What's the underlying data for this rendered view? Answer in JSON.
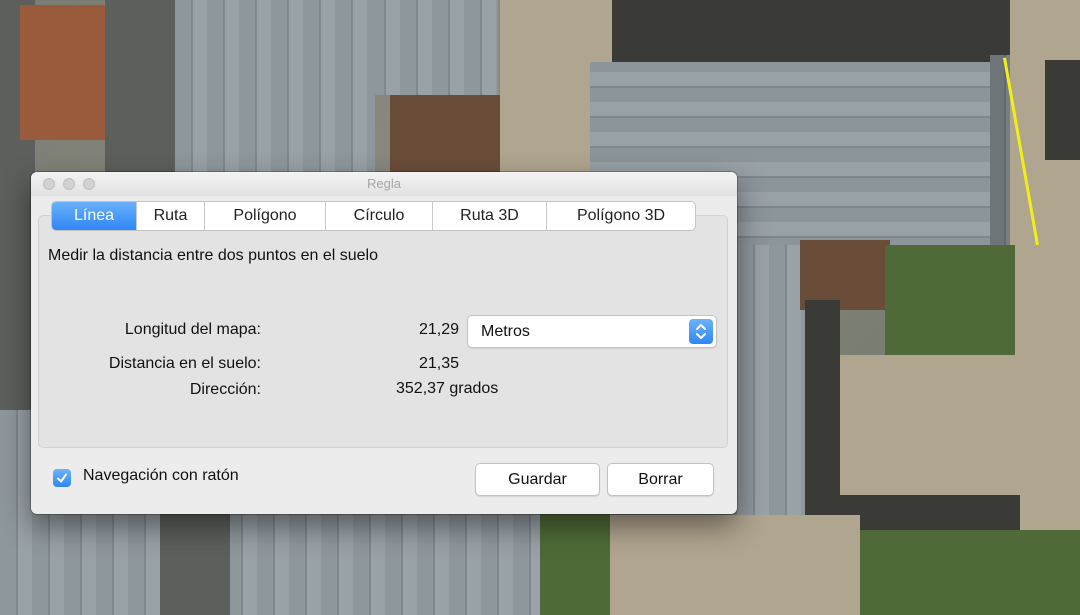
{
  "window": {
    "title": "Regla"
  },
  "tabs": [
    "Línea",
    "Ruta",
    "Polígono",
    "Círculo",
    "Ruta 3D",
    "Polígono 3D"
  ],
  "active_tab": "Línea",
  "description": "Medir la distancia entre dos puntos en el suelo",
  "measurements": {
    "map_length": {
      "label": "Longitud del mapa:",
      "value": "21,29"
    },
    "ground_distance": {
      "label": "Distancia en el suelo:",
      "value": "21,35"
    },
    "heading": {
      "label": "Dirección:",
      "value": "352,37 grados"
    }
  },
  "unit_select": {
    "selected": "Metros"
  },
  "mouse_navigation": {
    "label": "Navegación con ratón",
    "checked": true
  },
  "buttons": {
    "save": "Guardar",
    "clear": "Borrar"
  },
  "colors": {
    "accent": "#2f86f6",
    "measure_line": "#f4ee17"
  }
}
